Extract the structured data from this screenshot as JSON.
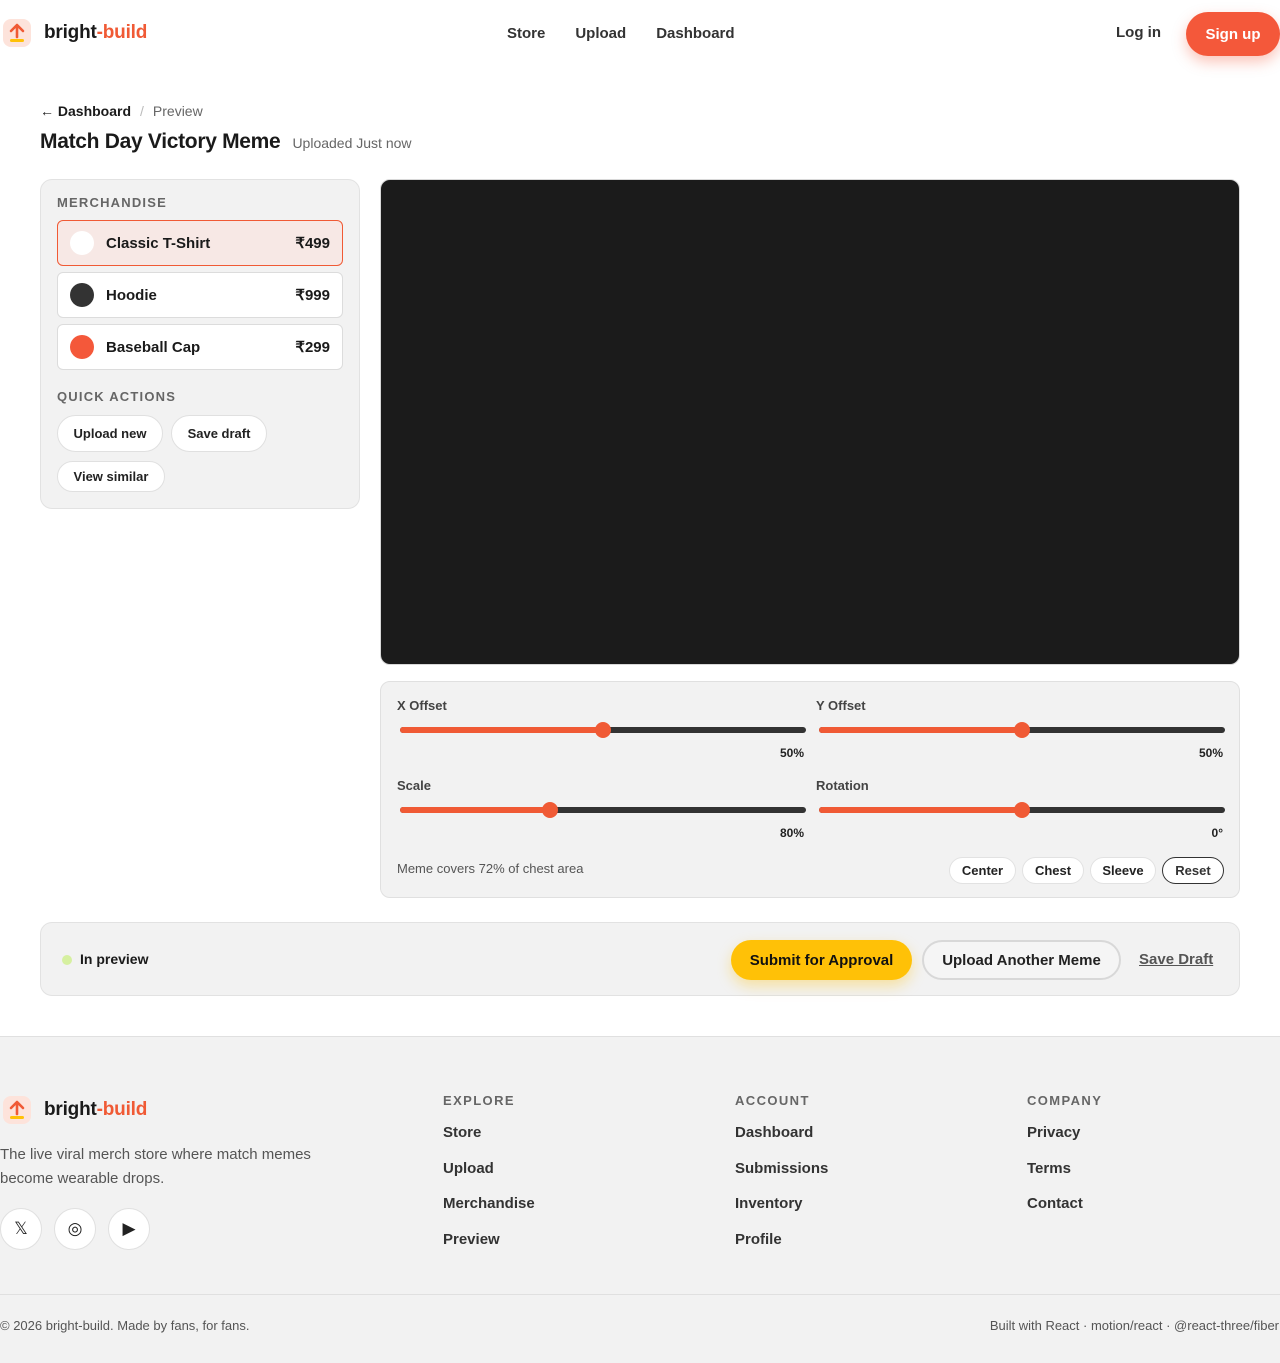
{
  "brand": {
    "name_main": "bright",
    "name_accent": "-build"
  },
  "nav": {
    "items": [
      "Store",
      "Upload",
      "Dashboard"
    ],
    "login": "Log in",
    "signup": "Sign up"
  },
  "breadcrumb": {
    "back": "← Dashboard",
    "separator": "/",
    "current": "Preview"
  },
  "page": {
    "title": "Match Day Victory Meme",
    "uploaded": "Uploaded Just now"
  },
  "sidebar": {
    "merch_label": "MERCHANDISE",
    "items": [
      {
        "name": "Classic T-Shirt",
        "price": "₹499",
        "color": "#ffffff",
        "selected": true
      },
      {
        "name": "Hoodie",
        "price": "₹999",
        "color": "#333333",
        "selected": false
      },
      {
        "name": "Baseball Cap",
        "price": "₹299",
        "color": "#f4583a",
        "selected": false
      }
    ],
    "quick_label": "QUICK ACTIONS",
    "quick_actions": [
      "Upload new",
      "Save draft",
      "View similar"
    ]
  },
  "controls": {
    "x_offset": {
      "label": "X Offset",
      "value": "50%",
      "level": 0.5
    },
    "y_offset": {
      "label": "Y Offset",
      "value": "50%",
      "level": 0.5
    },
    "scale": {
      "label": "Scale",
      "value": "80%",
      "level": 0.37
    },
    "rotation": {
      "label": "Rotation",
      "value": "0°",
      "level": 0.5
    },
    "coverage": "Meme covers 72% of chest area",
    "presets": [
      "Center",
      "Chest",
      "Sleeve",
      "Reset"
    ]
  },
  "actionbar": {
    "status": "In preview",
    "submit": "Submit for Approval",
    "upload_another": "Upload Another Meme",
    "save_draft": "Save Draft"
  },
  "footer": {
    "tagline": "The live viral merch store where match memes become wearable drops.",
    "social_icons": [
      "x-icon",
      "instagram-icon",
      "youtube-icon"
    ],
    "explore": {
      "title": "EXPLORE",
      "links": [
        "Store",
        "Upload",
        "Merchandise",
        "Preview"
      ]
    },
    "account": {
      "title": "ACCOUNT",
      "links": [
        "Dashboard",
        "Submissions",
        "Inventory",
        "Profile"
      ]
    },
    "company": {
      "title": "COMPANY",
      "links": [
        "Privacy",
        "Terms",
        "Contact"
      ]
    },
    "copyright": "© 2026 bright-build. Made by fans, for fans.",
    "built_with": "Built with React · motion/react · @react-three/fiber"
  },
  "colors": {
    "accent": "#f05a35",
    "submit": "#ffc107",
    "canvas": "#1b1b1b",
    "status_dot": "#d6f0a0"
  }
}
